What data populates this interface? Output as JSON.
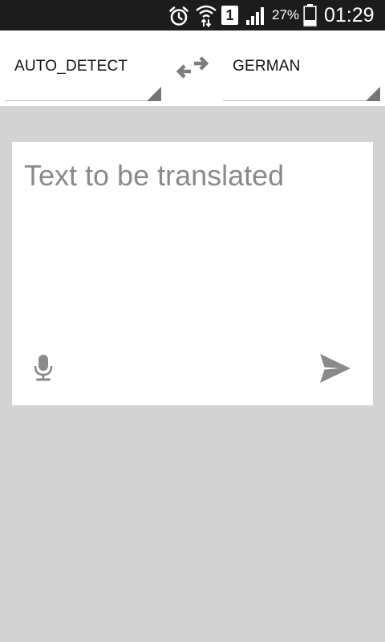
{
  "status_bar": {
    "sim_slot": "1",
    "battery_percent": "27%",
    "time": "01:29",
    "icons": [
      "alarm-icon",
      "wifi-icon",
      "sim-icon",
      "signal-icon",
      "battery-icon"
    ]
  },
  "language_bar": {
    "source_language": "AUTO_DETECT",
    "target_language": "GERMAN",
    "swap_icon": "swap-arrows-icon"
  },
  "input": {
    "placeholder": "Text to be translated",
    "value": ""
  },
  "actions": {
    "mic_icon": "microphone-icon",
    "send_icon": "send-icon"
  },
  "colors": {
    "status_bar_bg": "#1c1c1c",
    "background": "#d3d3d3",
    "card": "#ffffff",
    "icon_gray": "#8a8a8a",
    "placeholder": "#8a8a8a"
  }
}
